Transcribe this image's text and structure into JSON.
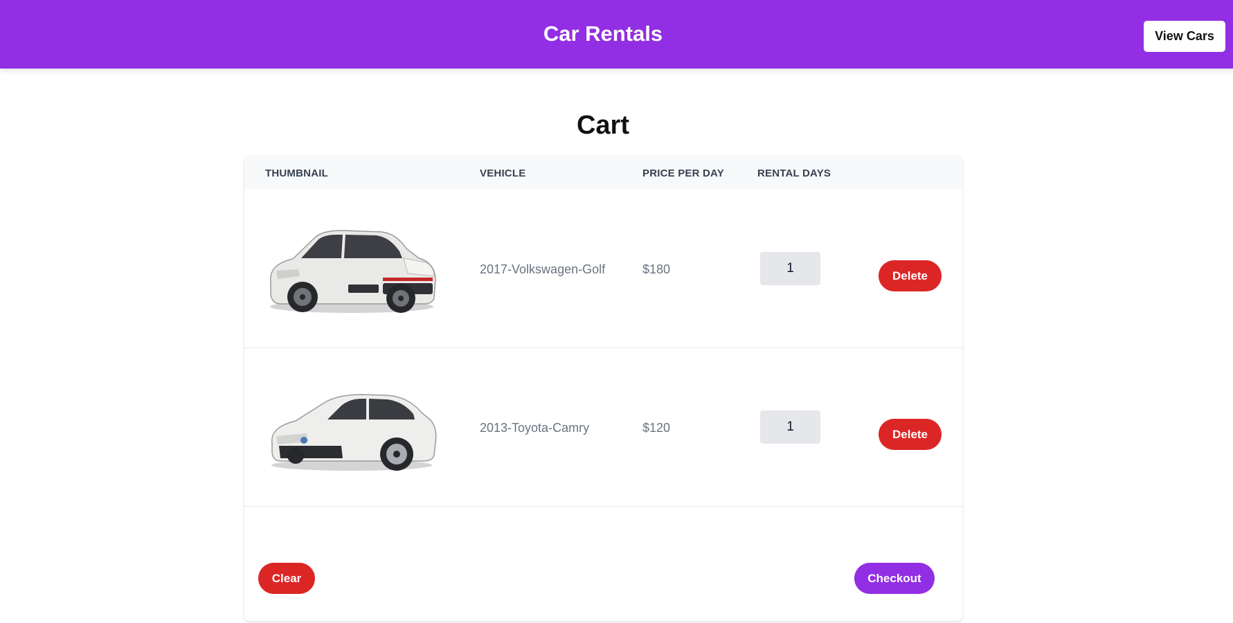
{
  "header": {
    "title": "Car Rentals",
    "view_cars_label": "View Cars",
    "background_color": "#922ee3"
  },
  "page": {
    "title": "Cart"
  },
  "table": {
    "columns": [
      "THUMBNAIL",
      "VEHICLE",
      "PRICE PER DAY",
      "RENTAL DAYS"
    ],
    "rows": [
      {
        "thumbnail_icon": "hatchback-car-image",
        "vehicle": "2017-Volkswagen-Golf",
        "price_per_day": "$180",
        "rental_days": "1",
        "delete_label": "Delete"
      },
      {
        "thumbnail_icon": "sedan-car-image",
        "vehicle": "2013-Toyota-Camry",
        "price_per_day": "$120",
        "rental_days": "1",
        "delete_label": "Delete"
      }
    ]
  },
  "actions": {
    "clear_label": "Clear",
    "checkout_label": "Checkout"
  },
  "colors": {
    "accent": "#922ee3",
    "danger": "#dc2626"
  }
}
